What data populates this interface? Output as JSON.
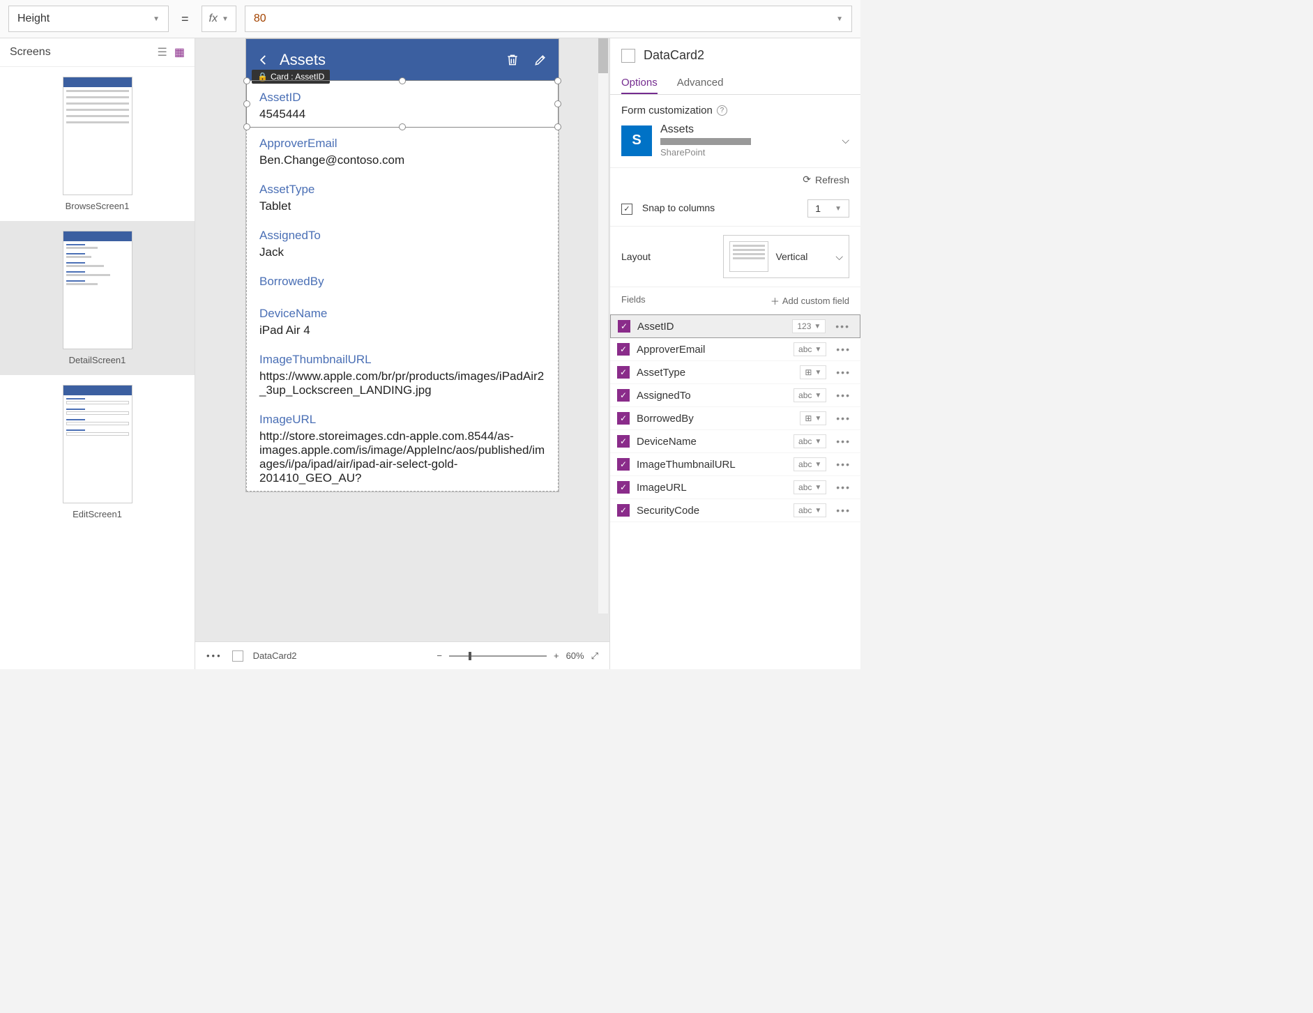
{
  "formula_bar": {
    "property": "Height",
    "equals": "=",
    "fx": "fx",
    "value": "80"
  },
  "screens_panel": {
    "title": "Screens",
    "items": [
      {
        "name": "BrowseScreen1"
      },
      {
        "name": "DetailScreen1"
      },
      {
        "name": "EditScreen1"
      }
    ]
  },
  "canvas": {
    "app_title": "Assets",
    "tooltip": "Card : AssetID",
    "cards": [
      {
        "label": "AssetID",
        "value": "4545444",
        "selected": true
      },
      {
        "label": "ApproverEmail",
        "value": "Ben.Change@contoso.com"
      },
      {
        "label": "AssetType",
        "value": "Tablet"
      },
      {
        "label": "AssignedTo",
        "value": "Jack"
      },
      {
        "label": "BorrowedBy",
        "value": ""
      },
      {
        "label": "DeviceName",
        "value": "iPad Air 4"
      },
      {
        "label": "ImageThumbnailURL",
        "value": "https://www.apple.com/br/pr/products/images/iPadAir2_3up_Lockscreen_LANDING.jpg"
      },
      {
        "label": "ImageURL",
        "value": "http://store.storeimages.cdn-apple.com.8544/as-images.apple.com/is/image/AppleInc/aos/published/images/i/pa/ipad/air/ipad-air-select-gold-201410_GEO_AU?"
      }
    ]
  },
  "footer": {
    "breadcrumb": "DataCard2",
    "zoom": "60%"
  },
  "right_panel": {
    "title": "DataCard2",
    "tabs": {
      "options": "Options",
      "advanced": "Advanced"
    },
    "form_customization": "Form customization",
    "datasource": {
      "name": "Assets",
      "type": "SharePoint"
    },
    "refresh": "Refresh",
    "snap_label": "Snap to columns",
    "snap_columns": "1",
    "layout_label": "Layout",
    "layout_value": "Vertical",
    "fields_label": "Fields",
    "add_custom": "Add custom field",
    "fields": [
      {
        "name": "AssetID",
        "type": "123",
        "active": true
      },
      {
        "name": "ApproverEmail",
        "type": "abc"
      },
      {
        "name": "AssetType",
        "type": "grid"
      },
      {
        "name": "AssignedTo",
        "type": "abc"
      },
      {
        "name": "BorrowedBy",
        "type": "grid"
      },
      {
        "name": "DeviceName",
        "type": "abc"
      },
      {
        "name": "ImageThumbnailURL",
        "type": "abc"
      },
      {
        "name": "ImageURL",
        "type": "abc"
      },
      {
        "name": "SecurityCode",
        "type": "abc"
      }
    ]
  }
}
